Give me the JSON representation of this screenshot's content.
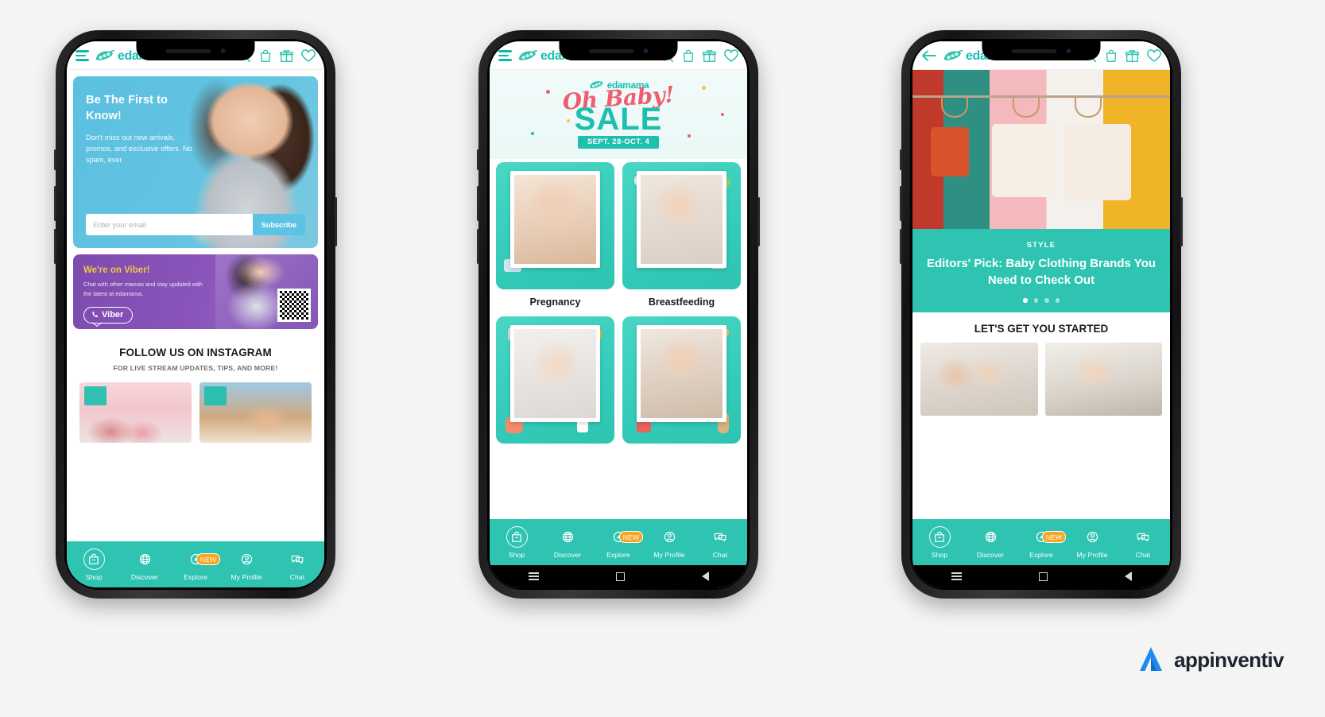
{
  "brand": {
    "name": "edamama",
    "trademark": "®",
    "color": "#17bfae"
  },
  "header_icons": [
    "search-icon",
    "bag-icon",
    "gift-icon",
    "heart-icon"
  ],
  "tabbar": {
    "items": [
      {
        "label": "Shop",
        "icon": "shop-bag-icon",
        "active": true,
        "badge": ""
      },
      {
        "label": "Discover",
        "icon": "globe-icon",
        "active": false,
        "badge": ""
      },
      {
        "label": "Explore",
        "icon": "compass-icon",
        "active": false,
        "badge": "NEW"
      },
      {
        "label": "My Profile",
        "icon": "person-icon",
        "active": false,
        "badge": ""
      },
      {
        "label": "Chat",
        "icon": "chat-icon",
        "active": false,
        "badge": ""
      }
    ]
  },
  "phone1": {
    "menu_icon": "hamburger-icon",
    "hero": {
      "title": "Be The First to Know!",
      "body": "Don't miss out new arrivals, promos, and exclusive offers. No spam, ever.",
      "email_placeholder": "Enter your email",
      "email_value": "",
      "subscribe_label": "Subscribe"
    },
    "viber": {
      "title": "We're on Viber!",
      "body": "Chat with other mamas and stay updated with the latest at edamama.",
      "button_label": "Viber",
      "qr_name": "viber-qr-code"
    },
    "instagram": {
      "title": "FOLLOW US ON INSTAGRAM",
      "subtitle": "FOR LIVE STREAM UPDATES, TIPS, AND MORE!",
      "prev_icon": "chevron-left-icon",
      "next_icon": "chevron-right-icon",
      "cards": [
        "instagram-post-sale-kids",
        "instagram-post-sale-baby"
      ]
    }
  },
  "phone2": {
    "menu_icon": "hamburger-icon",
    "sale_banner": {
      "brand": "edamama",
      "script_line": "Oh Baby!",
      "headline": "SALE",
      "dates": "SEPT. 28-OCT. 4"
    },
    "categories": [
      {
        "label": "Pregnancy",
        "image": "pregnancy-photo"
      },
      {
        "label": "Breastfeeding",
        "image": "breastfeeding-photo"
      },
      {
        "label": "",
        "image": "baby-gear-photo"
      },
      {
        "label": "",
        "image": "toys-photo"
      }
    ]
  },
  "phone3": {
    "back_icon": "back-arrow-icon",
    "hero_image": "baby-clothing-rack-photo",
    "editorial": {
      "kicker": "STYLE",
      "title": "Editors' Pick: Baby Clothing Brands You Need to Check Out",
      "dots_total": 4,
      "dots_active": 1
    },
    "started": {
      "title": "LET'S GET YOU STARTED",
      "thumbs": [
        "family-tablet-photo",
        "mom-laptop-photo"
      ]
    }
  },
  "system_bar": {
    "icons": [
      "recents-icon",
      "home-icon",
      "back-icon"
    ]
  },
  "footer_logo": {
    "name": "appinventiv",
    "mark": "appinventiv-logo-mark",
    "color": "#1d8bf1"
  }
}
